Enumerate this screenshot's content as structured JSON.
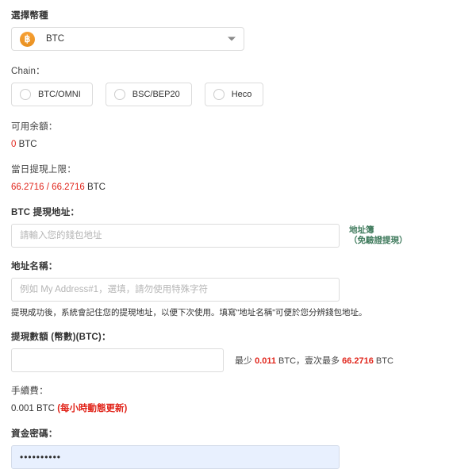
{
  "currency": {
    "label": "選擇幣種",
    "icon": "bitcoin-icon",
    "icon_glyph": "฿",
    "selected": "BTC",
    "caret": "chevron-down-icon",
    "accent_color": "#f0a030"
  },
  "chain": {
    "label": "Chain：",
    "options": [
      {
        "label": "BTC/OMNI",
        "selected": false
      },
      {
        "label": "BSC/BEP20",
        "selected": false
      },
      {
        "label": "Heco",
        "selected": false
      }
    ]
  },
  "balance": {
    "label": "可用余額：",
    "amount": "0",
    "unit": "BTC"
  },
  "daily_limit": {
    "label": "當日提現上限：",
    "used": "66.2716",
    "separator": " / ",
    "total": "66.2716",
    "unit": "BTC"
  },
  "withdraw_address": {
    "label": "BTC 提現地址：",
    "placeholder": "請輸入您的錢包地址",
    "value": "",
    "link_main": "地址簿",
    "link_sub": "（免驗證提現）",
    "link_color": "#3f7a5c"
  },
  "address_name": {
    "label": "地址名稱：",
    "placeholder": "例如 My Address#1，選填，請勿使用特殊字符",
    "value": "",
    "helper": "提現成功後，系統會記住您的提現地址，以便下次使用。填寫\"地址名稱\"可便於您分辨錢包地址。"
  },
  "amount": {
    "label": "提現數額 (幣數)(BTC)：",
    "value": "",
    "placeholder": "",
    "hint_prefix": "最少 ",
    "hint_min": "0.011",
    "hint_middle": " BTC，壹次最多 ",
    "hint_max": "66.2716",
    "hint_suffix": " BTC"
  },
  "fee": {
    "label": "手續費：",
    "amount": "0.001 BTC",
    "note": "(每小時動態更新)",
    "note_color": "#e1251b"
  },
  "fund_password": {
    "label": "資金密碼：",
    "value": "••••••••••",
    "placeholder": ""
  }
}
